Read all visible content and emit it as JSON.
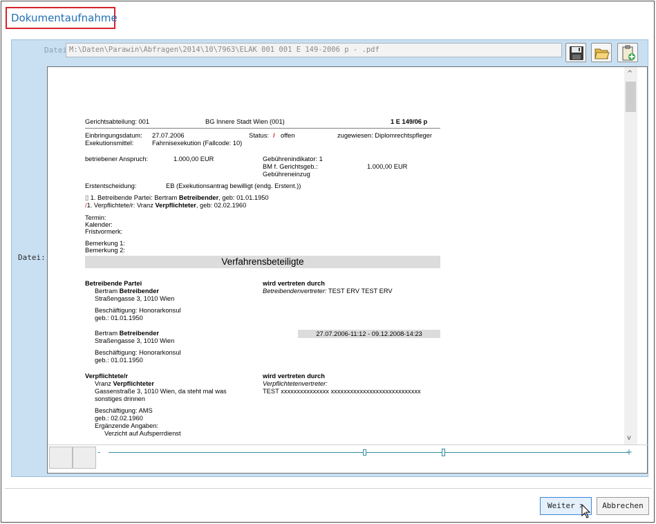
{
  "window": {
    "title": "Dokumentaufnahme"
  },
  "file": {
    "label_top": "Datei",
    "path": "M:\\Daten\\Parawin\\Abfragen\\2014\\10\\7963\\ELAK 001 001 E 149-2006 p - .pdf",
    "label_left": "Datei:"
  },
  "toolbar": {
    "icons": [
      "save-icon",
      "open-folder-icon",
      "clipboard-add-icon"
    ]
  },
  "document": {
    "line1_left": "Gerichtsabteilung: 001",
    "line1_mid": "BG Innere Stadt Wien (001)",
    "line1_right": "1 E 149/06 p",
    "einbringung_label": "Einbringungsdatum:",
    "einbringung_value": "27.07.2006",
    "status_label": "Status:",
    "status_value": "offen",
    "zugewiesen": "zugewiesen: Diplomrechtspfleger",
    "exekutionsmittel_label": "Exekutionsmittel:",
    "exekutionsmittel_value": "Fahrnisexekution (Fallcode: 10)",
    "anspruch_label": "betriebener Anspruch:",
    "anspruch_value": "1.000,00 EUR",
    "gebuehr1": "Gebührenindikator: 1",
    "gebuehr2": "BM f. Gerichtsgeb.:",
    "gebuehr2_value": "1.000,00 EUR",
    "gebuehr3": "Gebühreneinzug",
    "erstentscheidung_label": "Erstentscheidung:",
    "erstentscheidung_value": "EB (Exekutionsantrag bewilligt (endg. Erstent.))",
    "party1_prefix": "1. Betreibende Partei: Bertram ",
    "party1_bold": "Betreibender",
    "party1_suffix": ", geb: 01.01.1950",
    "party2_prefix": "1. Verpflichtete/r: Vranz ",
    "party2_bold": "Verpflichteter",
    "party2_suffix": ", geb: 02.02.1960",
    "termin": "Termin:",
    "kalender": "Kalender:",
    "fristvormerk": "Fristvormerk:",
    "bemerkung1": "Bemerkung 1:",
    "bemerkung2": "Bemerkung 2:",
    "section_title": "Verfahrensbeteiligte",
    "bp_heading": "Betreibende Partei",
    "bp_vertreten": "wird vertreten durch",
    "bp_name_prefix": "Bertram ",
    "bp_name_bold": "Betreibender",
    "bp_vertreter_label": "Betreibendenvertreter:",
    "bp_vertreter_value": " TEST ERV TEST ERV",
    "bp_address": "Straßengasse 3, 1010 Wien",
    "bp_beschaeftigung": "Beschäftigung: Honorarkonsul",
    "bp_geb": "geb.: 01.01.1950",
    "bp2_name_prefix": "Bertram ",
    "bp2_name_bold": "Betreibender",
    "bp2_daterange": "27.07.2006-11:12 - 09.12.2008-14:23",
    "bp2_address": "Straßengasse 3, 1010 Wien",
    "bp2_beschaeftigung": "Beschäftigung: Honorarkonsul",
    "bp2_geb": "geb.: 01.01.1950",
    "vp_heading": "Verpflichtete/r",
    "vp_vertreten": "wird vertreten durch",
    "vp_name_prefix": "Vranz ",
    "vp_name_bold": "Verpflichteter",
    "vp_vertreter_label": "Verpflichtetenvertreter:",
    "vp_address1": "Gassenstraße 3, 1010 Wien, da steht mal was",
    "vp_vertreter_value": "TEST xxxxxxxxxxxxxxx xxxxxxxxxxxxxxxxxxxxxxxxxxxx",
    "vp_address2": "sonstiges drinnen",
    "vp_beschaeftigung": "Beschäftigung: AMS",
    "vp_geb": "geb.: 02.02.1960",
    "vp_ergaenzend": "Ergänzende Angaben:",
    "vp_verzicht": "Verzicht auf Aufsperrdienst"
  },
  "viewer": {
    "scroll_up": "^",
    "scroll_down": "v",
    "slider_minus": "-",
    "slider_plus": "+"
  },
  "buttons": {
    "next_label": "Weiter >",
    "cancel_label": "Abbrechen"
  }
}
